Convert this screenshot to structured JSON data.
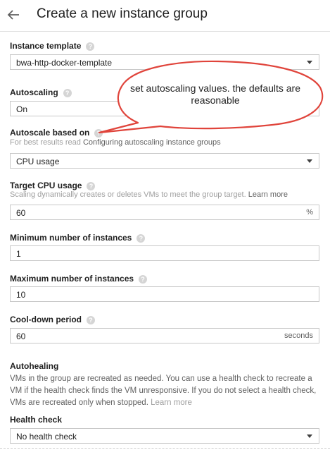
{
  "header": {
    "title": "Create a new instance group",
    "back_icon": "arrow-left-icon"
  },
  "instance_template": {
    "label": "Instance template",
    "value": "bwa-http-docker-template"
  },
  "autoscaling": {
    "label": "Autoscaling",
    "value": "On"
  },
  "callout": {
    "text": "set autoscaling values.  the defaults are reasonable"
  },
  "autoscale_based_on": {
    "label": "Autoscale based on",
    "hint_prefix": "For best results read ",
    "hint_link": "Configuring autoscaling instance groups",
    "value": "CPU usage"
  },
  "target_cpu": {
    "label": "Target CPU usage",
    "hint": "Scaling dynamically creates or deletes VMs to meet the group target.",
    "hint_link": "Learn more",
    "value": "60",
    "suffix": "%"
  },
  "min_instances": {
    "label": "Minimum number of instances",
    "value": "1"
  },
  "max_instances": {
    "label": "Maximum number of instances",
    "value": "10"
  },
  "cooldown": {
    "label": "Cool-down period",
    "value": "60",
    "suffix": "seconds"
  },
  "autohealing": {
    "title": "Autohealing",
    "text": "VMs in the group are recreated as needed. You can use a health check to recreate a VM if the health check finds the VM unresponsive. If you do not select a health check, VMs are recreated only when stopped.",
    "link": "Learn more"
  },
  "health_check": {
    "label": "Health check",
    "value": "No health check"
  },
  "help_icon_glyph": "?",
  "colors": {
    "callout_border": "#e0443b",
    "field_border": "#c8c8c8"
  }
}
